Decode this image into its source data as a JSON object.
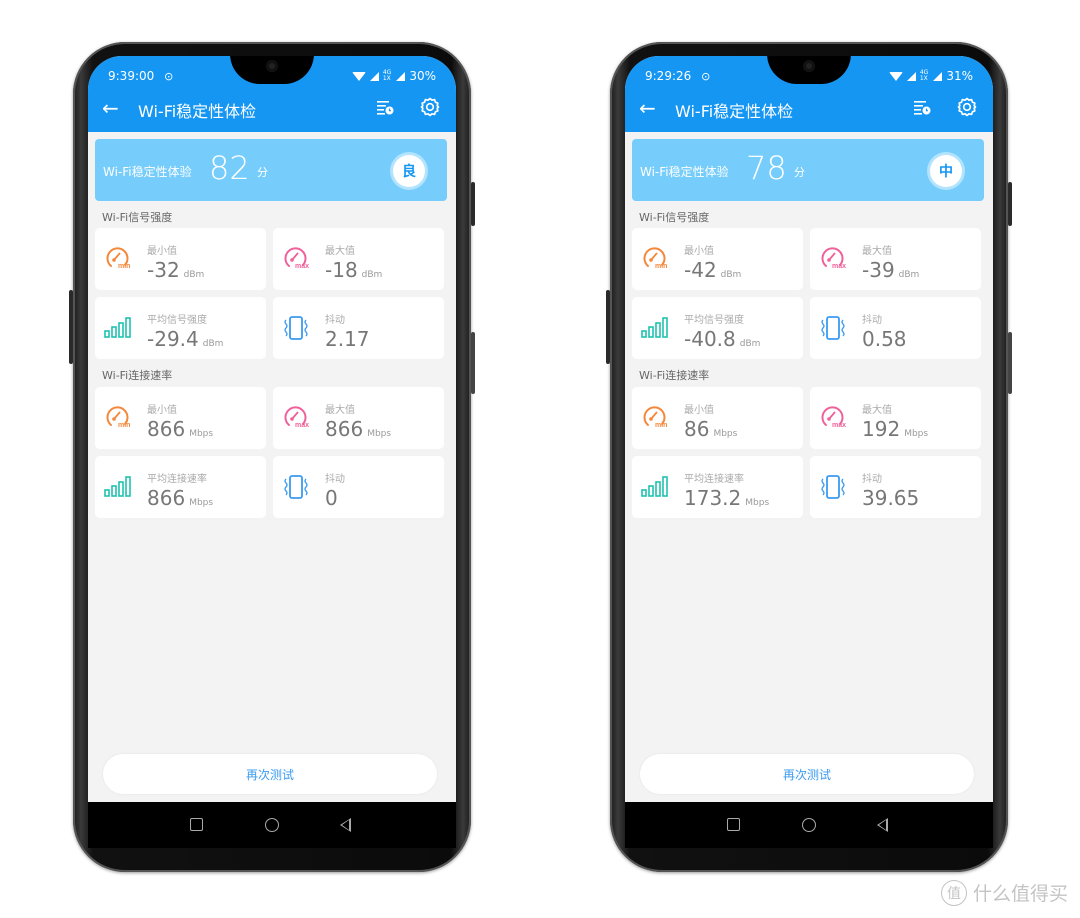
{
  "phones": [
    {
      "status": {
        "time": "9:39:00",
        "battery": "30%",
        "net_top": "4G",
        "net_bottom": "1X"
      },
      "appbar": {
        "title": "Wi-Fi稳定性体检"
      },
      "score": {
        "label": "Wi-Fi稳定性体验",
        "value": "82",
        "unit": "分",
        "grade": "良"
      },
      "signal": {
        "section_label": "Wi-Fi信号强度",
        "min": {
          "label": "最小值",
          "value": "-32",
          "unit": "dBm"
        },
        "max": {
          "label": "最大值",
          "value": "-18",
          "unit": "dBm"
        },
        "avg": {
          "label": "平均信号强度",
          "value": "-29.4",
          "unit": "dBm"
        },
        "jitter": {
          "label": "抖动",
          "value": "2.17",
          "unit": ""
        }
      },
      "rate": {
        "section_label": "Wi-Fi连接速率",
        "min": {
          "label": "最小值",
          "value": "866",
          "unit": "Mbps"
        },
        "max": {
          "label": "最大值",
          "value": "866",
          "unit": "Mbps"
        },
        "avg": {
          "label": "平均连接速率",
          "value": "866",
          "unit": "Mbps"
        },
        "jitter": {
          "label": "抖动",
          "value": "0",
          "unit": ""
        }
      },
      "retest_label": "再次测试"
    },
    {
      "status": {
        "time": "9:29:26",
        "battery": "31%",
        "net_top": "4G",
        "net_bottom": "1X"
      },
      "appbar": {
        "title": "Wi-Fi稳定性体检"
      },
      "score": {
        "label": "Wi-Fi稳定性体验",
        "value": "78",
        "unit": "分",
        "grade": "中"
      },
      "signal": {
        "section_label": "Wi-Fi信号强度",
        "min": {
          "label": "最小值",
          "value": "-42",
          "unit": "dBm"
        },
        "max": {
          "label": "最大值",
          "value": "-39",
          "unit": "dBm"
        },
        "avg": {
          "label": "平均信号强度",
          "value": "-40.8",
          "unit": "dBm"
        },
        "jitter": {
          "label": "抖动",
          "value": "0.58",
          "unit": ""
        }
      },
      "rate": {
        "section_label": "Wi-Fi连接速率",
        "min": {
          "label": "最小值",
          "value": "86",
          "unit": "Mbps"
        },
        "max": {
          "label": "最大值",
          "value": "192",
          "unit": "Mbps"
        },
        "avg": {
          "label": "平均连接速率",
          "value": "173.2",
          "unit": "Mbps"
        },
        "jitter": {
          "label": "抖动",
          "value": "39.65",
          "unit": ""
        }
      },
      "retest_label": "再次测试"
    }
  ],
  "icons": {
    "min": "speedometer-min-icon",
    "max": "speedometer-max-icon",
    "avg": "signal-bars-icon",
    "jitter": "vibrate-phone-icon"
  },
  "colors": {
    "appbar": "#1596f3",
    "score_card": "#76cdfb",
    "min_icon": "#f5873a",
    "max_icon": "#f0609a",
    "avg_icon": "#1fc1b0",
    "jitter_icon": "#3a9af0"
  },
  "watermark": {
    "symbol": "值",
    "text": "什么值得买"
  }
}
